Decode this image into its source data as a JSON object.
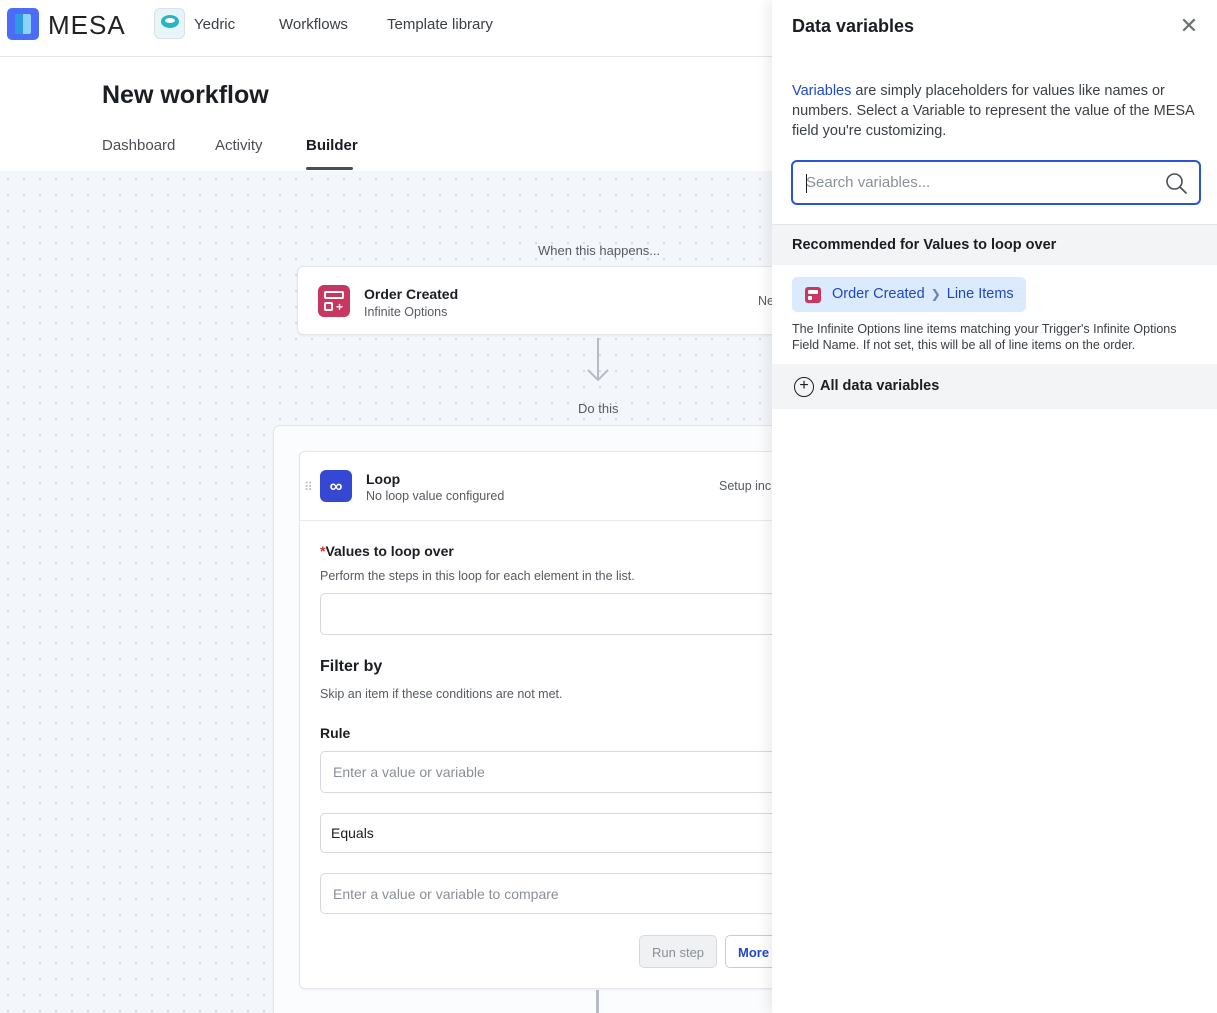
{
  "nav": {
    "brand": "MESA",
    "store_name": "Yedric",
    "links": [
      "Workflows",
      "Template library"
    ]
  },
  "page": {
    "title": "New workflow",
    "tabs": [
      "Dashboard",
      "Activity",
      "Builder"
    ],
    "active_tab": "Builder"
  },
  "builder": {
    "trigger_caption": "When this happens...",
    "trigger": {
      "title": "Order Created",
      "app": "Infinite Options",
      "side_text": "Ne"
    },
    "action_caption": "Do this",
    "loop": {
      "title": "Loop",
      "status": "No loop value configured",
      "side_text": "Setup inc",
      "values_label": "Values to loop over",
      "values_help": "Perform the steps in this loop for each element in the list.",
      "filter_title": "Filter by",
      "filter_help": "Skip an item if these conditions are not met.",
      "rule_label": "Rule",
      "rule_placeholder": "Enter a value or variable",
      "operator_value": "Equals",
      "compare_placeholder": "Enter a value or variable to compare",
      "run_step": "Run step",
      "more": "More t"
    }
  },
  "panel": {
    "title": "Data variables",
    "desc_link": "Variables",
    "desc_rest": " are simply placeholders for values like names or numbers. Select a Variable to represent the value of the MESA field you're customizing.",
    "search_placeholder": "Search variables...",
    "recommended_heading": "Recommended for Values to loop over",
    "chip": {
      "source": "Order Created",
      "field": "Line Items"
    },
    "chip_desc": "The Infinite Options line items matching your Trigger's Infinite Options Field Name. If not set, this will be all of line items on the order.",
    "all_label": "All data variables"
  },
  "colors": {
    "accent_blue": "#2a55d8",
    "trigger_pink": "#c8375f",
    "loop_blue": "#3548d4"
  }
}
